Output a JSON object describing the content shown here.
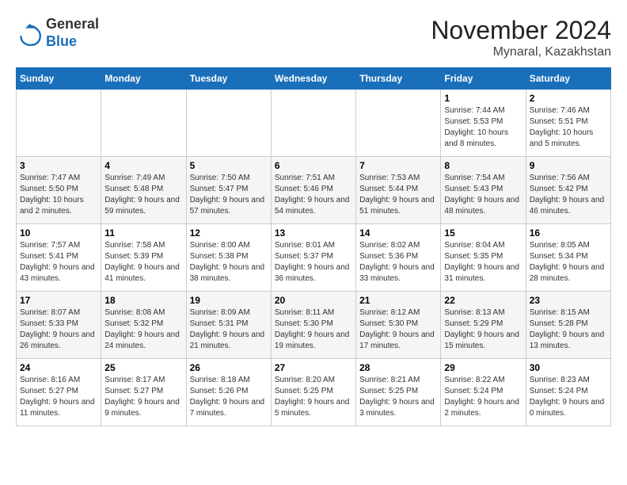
{
  "header": {
    "logo": {
      "general": "General",
      "blue": "Blue"
    },
    "title": "November 2024",
    "location": "Mynaral, Kazakhstan"
  },
  "weekdays": [
    "Sunday",
    "Monday",
    "Tuesday",
    "Wednesday",
    "Thursday",
    "Friday",
    "Saturday"
  ],
  "weeks": [
    [
      {
        "day": "",
        "info": ""
      },
      {
        "day": "",
        "info": ""
      },
      {
        "day": "",
        "info": ""
      },
      {
        "day": "",
        "info": ""
      },
      {
        "day": "",
        "info": ""
      },
      {
        "day": "1",
        "info": "Sunrise: 7:44 AM\nSunset: 5:53 PM\nDaylight: 10 hours and 8 minutes."
      },
      {
        "day": "2",
        "info": "Sunrise: 7:46 AM\nSunset: 5:51 PM\nDaylight: 10 hours and 5 minutes."
      }
    ],
    [
      {
        "day": "3",
        "info": "Sunrise: 7:47 AM\nSunset: 5:50 PM\nDaylight: 10 hours and 2 minutes."
      },
      {
        "day": "4",
        "info": "Sunrise: 7:49 AM\nSunset: 5:48 PM\nDaylight: 9 hours and 59 minutes."
      },
      {
        "day": "5",
        "info": "Sunrise: 7:50 AM\nSunset: 5:47 PM\nDaylight: 9 hours and 57 minutes."
      },
      {
        "day": "6",
        "info": "Sunrise: 7:51 AM\nSunset: 5:46 PM\nDaylight: 9 hours and 54 minutes."
      },
      {
        "day": "7",
        "info": "Sunrise: 7:53 AM\nSunset: 5:44 PM\nDaylight: 9 hours and 51 minutes."
      },
      {
        "day": "8",
        "info": "Sunrise: 7:54 AM\nSunset: 5:43 PM\nDaylight: 9 hours and 48 minutes."
      },
      {
        "day": "9",
        "info": "Sunrise: 7:56 AM\nSunset: 5:42 PM\nDaylight: 9 hours and 46 minutes."
      }
    ],
    [
      {
        "day": "10",
        "info": "Sunrise: 7:57 AM\nSunset: 5:41 PM\nDaylight: 9 hours and 43 minutes."
      },
      {
        "day": "11",
        "info": "Sunrise: 7:58 AM\nSunset: 5:39 PM\nDaylight: 9 hours and 41 minutes."
      },
      {
        "day": "12",
        "info": "Sunrise: 8:00 AM\nSunset: 5:38 PM\nDaylight: 9 hours and 38 minutes."
      },
      {
        "day": "13",
        "info": "Sunrise: 8:01 AM\nSunset: 5:37 PM\nDaylight: 9 hours and 36 minutes."
      },
      {
        "day": "14",
        "info": "Sunrise: 8:02 AM\nSunset: 5:36 PM\nDaylight: 9 hours and 33 minutes."
      },
      {
        "day": "15",
        "info": "Sunrise: 8:04 AM\nSunset: 5:35 PM\nDaylight: 9 hours and 31 minutes."
      },
      {
        "day": "16",
        "info": "Sunrise: 8:05 AM\nSunset: 5:34 PM\nDaylight: 9 hours and 28 minutes."
      }
    ],
    [
      {
        "day": "17",
        "info": "Sunrise: 8:07 AM\nSunset: 5:33 PM\nDaylight: 9 hours and 26 minutes."
      },
      {
        "day": "18",
        "info": "Sunrise: 8:08 AM\nSunset: 5:32 PM\nDaylight: 9 hours and 24 minutes."
      },
      {
        "day": "19",
        "info": "Sunrise: 8:09 AM\nSunset: 5:31 PM\nDaylight: 9 hours and 21 minutes."
      },
      {
        "day": "20",
        "info": "Sunrise: 8:11 AM\nSunset: 5:30 PM\nDaylight: 9 hours and 19 minutes."
      },
      {
        "day": "21",
        "info": "Sunrise: 8:12 AM\nSunset: 5:30 PM\nDaylight: 9 hours and 17 minutes."
      },
      {
        "day": "22",
        "info": "Sunrise: 8:13 AM\nSunset: 5:29 PM\nDaylight: 9 hours and 15 minutes."
      },
      {
        "day": "23",
        "info": "Sunrise: 8:15 AM\nSunset: 5:28 PM\nDaylight: 9 hours and 13 minutes."
      }
    ],
    [
      {
        "day": "24",
        "info": "Sunrise: 8:16 AM\nSunset: 5:27 PM\nDaylight: 9 hours and 11 minutes."
      },
      {
        "day": "25",
        "info": "Sunrise: 8:17 AM\nSunset: 5:27 PM\nDaylight: 9 hours and 9 minutes."
      },
      {
        "day": "26",
        "info": "Sunrise: 8:18 AM\nSunset: 5:26 PM\nDaylight: 9 hours and 7 minutes."
      },
      {
        "day": "27",
        "info": "Sunrise: 8:20 AM\nSunset: 5:25 PM\nDaylight: 9 hours and 5 minutes."
      },
      {
        "day": "28",
        "info": "Sunrise: 8:21 AM\nSunset: 5:25 PM\nDaylight: 9 hours and 3 minutes."
      },
      {
        "day": "29",
        "info": "Sunrise: 8:22 AM\nSunset: 5:24 PM\nDaylight: 9 hours and 2 minutes."
      },
      {
        "day": "30",
        "info": "Sunrise: 8:23 AM\nSunset: 5:24 PM\nDaylight: 9 hours and 0 minutes."
      }
    ]
  ]
}
